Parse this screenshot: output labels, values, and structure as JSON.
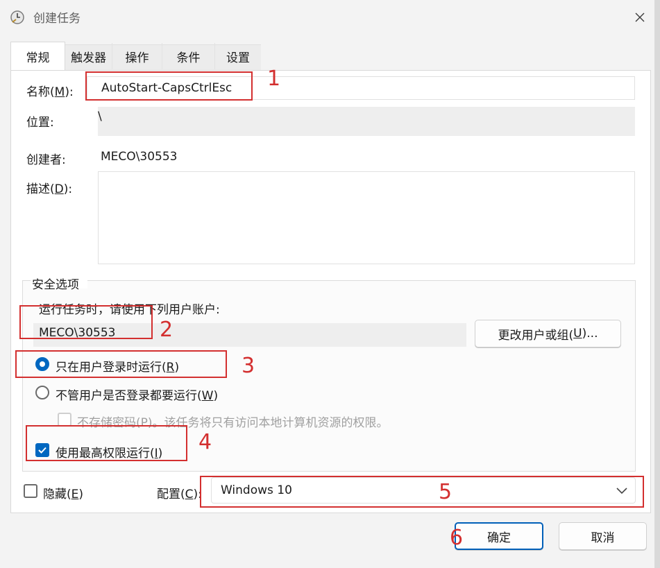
{
  "window": {
    "title": "创建任务"
  },
  "tabs": [
    {
      "label": "常规"
    },
    {
      "label": "触发器"
    },
    {
      "label": "操作"
    },
    {
      "label": "条件"
    },
    {
      "label": "设置"
    }
  ],
  "general": {
    "name_label": "名称(",
    "name_mn": "M",
    "name_tail": "):",
    "name_value": "AutoStart-CapsCtrlEsc",
    "location_label": "位置:",
    "location_value": "\\",
    "author_label": "创建者:",
    "author_value": "MECO\\30553",
    "desc_label": "描述(",
    "desc_mn": "D",
    "desc_tail": "):",
    "desc_value": ""
  },
  "security": {
    "group_title": "安全选项",
    "run_as_prompt": "运行任务时，请使用下列用户账户:",
    "user_value": "MECO\\30553",
    "change_user_button": "更改用户或组(",
    "change_user_mn": "U",
    "change_user_tail": ")...",
    "radio_logged_on": "只在用户登录时运行(",
    "radio_logged_on_mn": "R",
    "radio_logged_on_tail": ")",
    "radio_always": "不管用户是否登录都要运行(",
    "radio_always_mn": "W",
    "radio_always_tail": ")",
    "no_store_password": "不存储密码(P)。该任务将只有访问本地计算机资源的权限。",
    "highest_privileges": "使用最高权限运行(",
    "highest_privileges_mn": "I",
    "highest_privileges_tail": ")"
  },
  "bottom": {
    "hidden_label": "隐藏(",
    "hidden_mn": "E",
    "hidden_tail": ")",
    "config_label": "配置(",
    "config_mn": "C",
    "config_tail": "):",
    "config_value": "Windows 10"
  },
  "buttons": {
    "ok": "确定",
    "cancel": "取消"
  },
  "annotations": [
    "1",
    "2",
    "3",
    "4",
    "5",
    "6"
  ],
  "colors": {
    "accent": "#0067c0",
    "annotation": "#d32f2f"
  }
}
